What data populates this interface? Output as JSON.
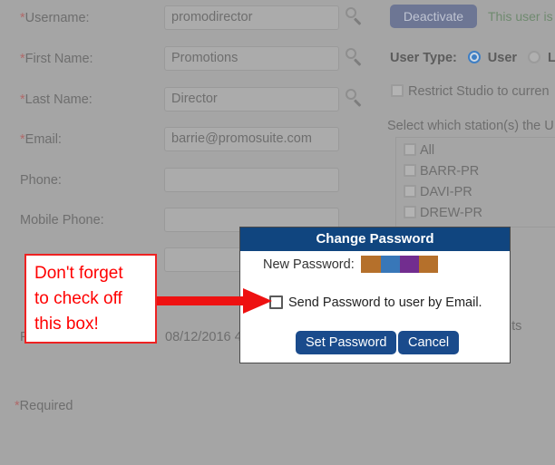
{
  "page": {
    "required_note": "*Required"
  },
  "form": {
    "fields": [
      {
        "label": "Username:",
        "required": true,
        "value": "promodirector",
        "has_lookup": true
      },
      {
        "label": "First Name:",
        "required": true,
        "value": "Promotions",
        "has_lookup": true
      },
      {
        "label": "Last Name:",
        "required": true,
        "value": "Director",
        "has_lookup": true
      },
      {
        "label": "Email:",
        "required": true,
        "value": "barrie@promosuite.com",
        "has_lookup": false
      },
      {
        "label": "Phone:",
        "required": false,
        "value": "",
        "has_lookup": false
      },
      {
        "label": "Mobile Phone:",
        "required": false,
        "value": "",
        "has_lookup": false
      }
    ],
    "password_changed_label": "Password Changed:",
    "password_changed_value": "08/12/2016 4"
  },
  "account": {
    "deactivate_label": "Deactivate",
    "status_text": "This user is",
    "user_type_label": "User Type:",
    "user_type_options": [
      {
        "label": "User",
        "selected": true
      },
      {
        "label": "Lo",
        "selected": false
      }
    ],
    "restrict_label": "Restrict Studio to curren",
    "restrict_checked": false,
    "stations_label": "Select which station(s) the U",
    "stations": [
      {
        "label": "All",
        "checked": false
      },
      {
        "label": "BARR-PR",
        "checked": false
      },
      {
        "label": "DAVI-PR",
        "checked": false
      },
      {
        "label": "DREW-PR",
        "checked": false
      }
    ],
    "right_fragment": "nts"
  },
  "modal": {
    "title": "Change Password",
    "new_password_label": "New Password:",
    "new_password_redaction_colors": [
      "#b5702b",
      "#3877b8",
      "#722d8f",
      "#b5702b"
    ],
    "send_email_label": "Send Password to user by Email.",
    "send_email_checked": false,
    "set_password_label": "Set Password",
    "cancel_label": "Cancel"
  },
  "annotation": {
    "callout_text": "Don't forget\nto check off\nthis box!",
    "callout_color": "#ff0000",
    "arrow_color": "#ee1111"
  }
}
